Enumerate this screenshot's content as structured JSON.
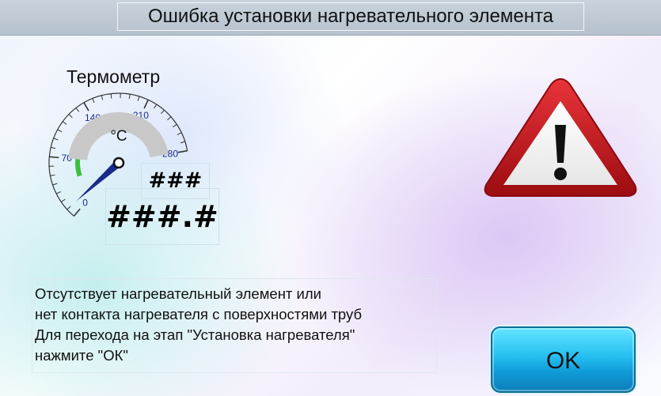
{
  "window": {
    "title": "Ошибка установки нагревательного элемента"
  },
  "thermometer": {
    "label": "Термометр",
    "unit": "°C",
    "scale_ticks": [
      "0",
      "70",
      "140",
      "210",
      "280"
    ],
    "range": [
      0,
      280
    ],
    "needle_value": 10,
    "value_small": "###",
    "value_large": "###.#"
  },
  "message": {
    "lines": [
      "Отсутствует нагревательный элемент или",
      "нет контакта нагревателя с поверхностями труб",
      "Для перехода на этап \"Установка нагревателя\"",
      "нажмите \"ОК\""
    ]
  },
  "ok_button": {
    "label": "OK"
  },
  "icons": {
    "warning": "warning-triangle-icon"
  },
  "colors": {
    "warning_red": "#c8141a",
    "button_blue": "#1fb4ea",
    "gauge_arc": "#c8c8c8",
    "gauge_green": "#3cbf3c",
    "needle": "#1a2a8a"
  }
}
